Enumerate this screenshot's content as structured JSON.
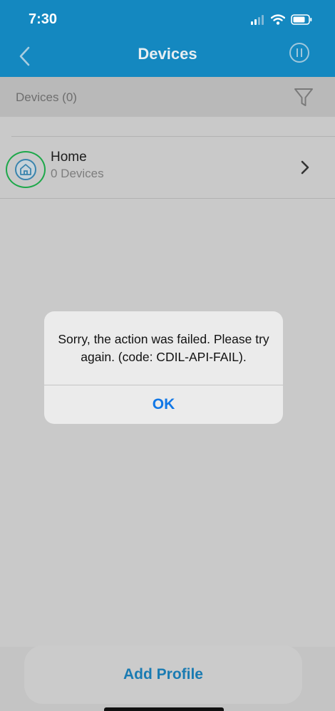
{
  "status_bar": {
    "time": "7:30"
  },
  "nav": {
    "title": "Devices"
  },
  "filter_bar": {
    "label": "Devices (0)"
  },
  "profiles": [
    {
      "name": "Home",
      "subtitle": "0 Devices"
    }
  ],
  "alert": {
    "message": "Sorry, the action was failed. Please try again. (code: CDIL-API-FAIL).",
    "ok_label": "OK"
  },
  "bottom": {
    "add_profile_label": "Add Profile"
  },
  "colors": {
    "header": "#1488c0",
    "ok_blue": "#1077e6",
    "highlight_ring": "#1ea84a"
  }
}
